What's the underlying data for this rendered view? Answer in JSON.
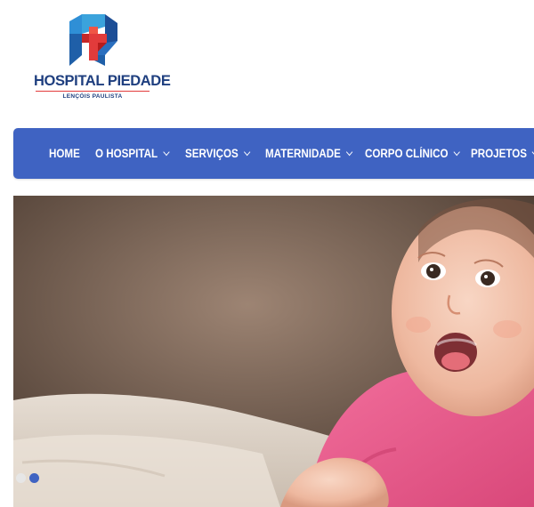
{
  "header": {
    "logo": {
      "name": "HOSPITAL PIEDADE",
      "city": "LENÇÓIS PAULISTA",
      "colors": {
        "blue": "#1f3f7f",
        "red": "#e23b3b",
        "light_blue": "#3ba3dc"
      }
    }
  },
  "nav": {
    "background": "#3f63c2",
    "items": [
      {
        "label": "HOME",
        "has_dropdown": false
      },
      {
        "label": "O HOSPITAL",
        "has_dropdown": true
      },
      {
        "label": "SERVIÇOS",
        "has_dropdown": true
      },
      {
        "label": "MATERNIDADE",
        "has_dropdown": true
      },
      {
        "label": "CORPO CLÍNICO",
        "has_dropdown": true
      },
      {
        "label": "PROJETOS",
        "has_dropdown": true
      }
    ]
  },
  "slider": {
    "image": "smiling-baby-photo",
    "total_slides": 2,
    "active_slide": 2,
    "dot_colors": {
      "inactive": "#e6e6e6",
      "active": "#3f63c2"
    }
  }
}
